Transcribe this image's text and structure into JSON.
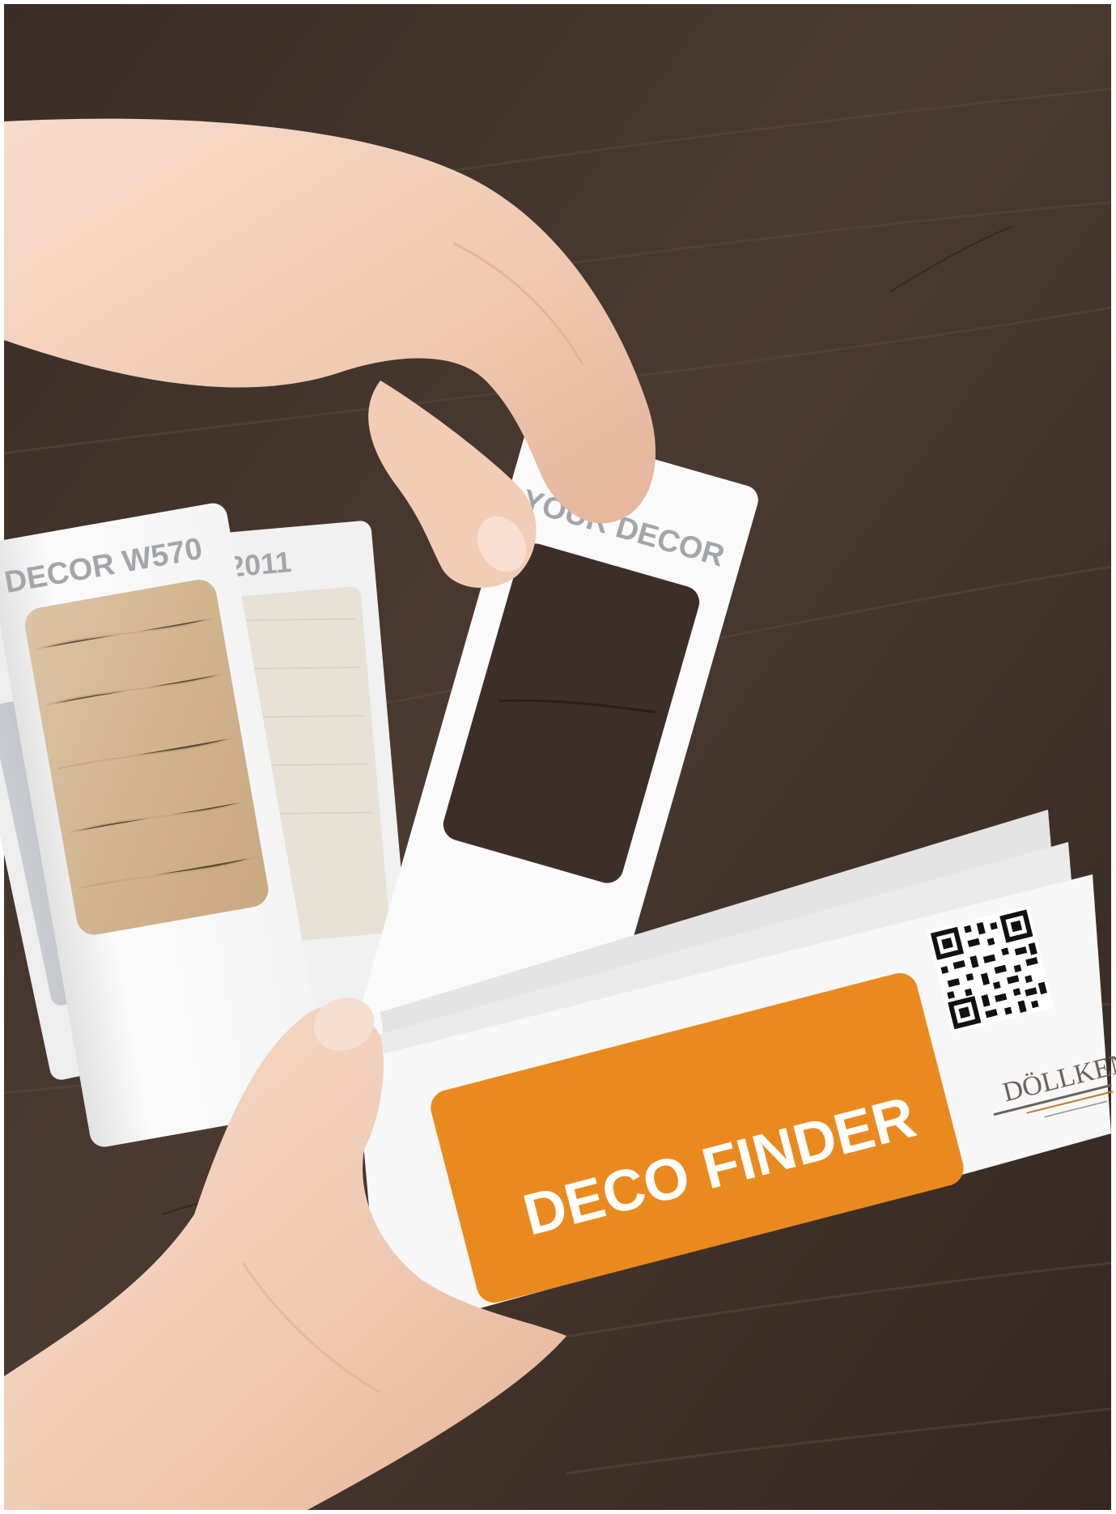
{
  "swatch_cards": {
    "decor_w570": "DECOR W570",
    "partial_code": "2011",
    "your_decor": "YOUR DECOR"
  },
  "cover": {
    "title": "DECO FINDER",
    "accent_color": "#ea8a1e"
  },
  "brand": {
    "logo_icon": "doellken-logo-icon",
    "qr_icon": "qr-code-icon"
  },
  "colors": {
    "wood_dark": "#3b2e26",
    "skin": "#f0cdb6",
    "card_white": "#f7f7f7",
    "label_grey": "#a3a6a9",
    "oak_swatch": "#d4b896"
  }
}
